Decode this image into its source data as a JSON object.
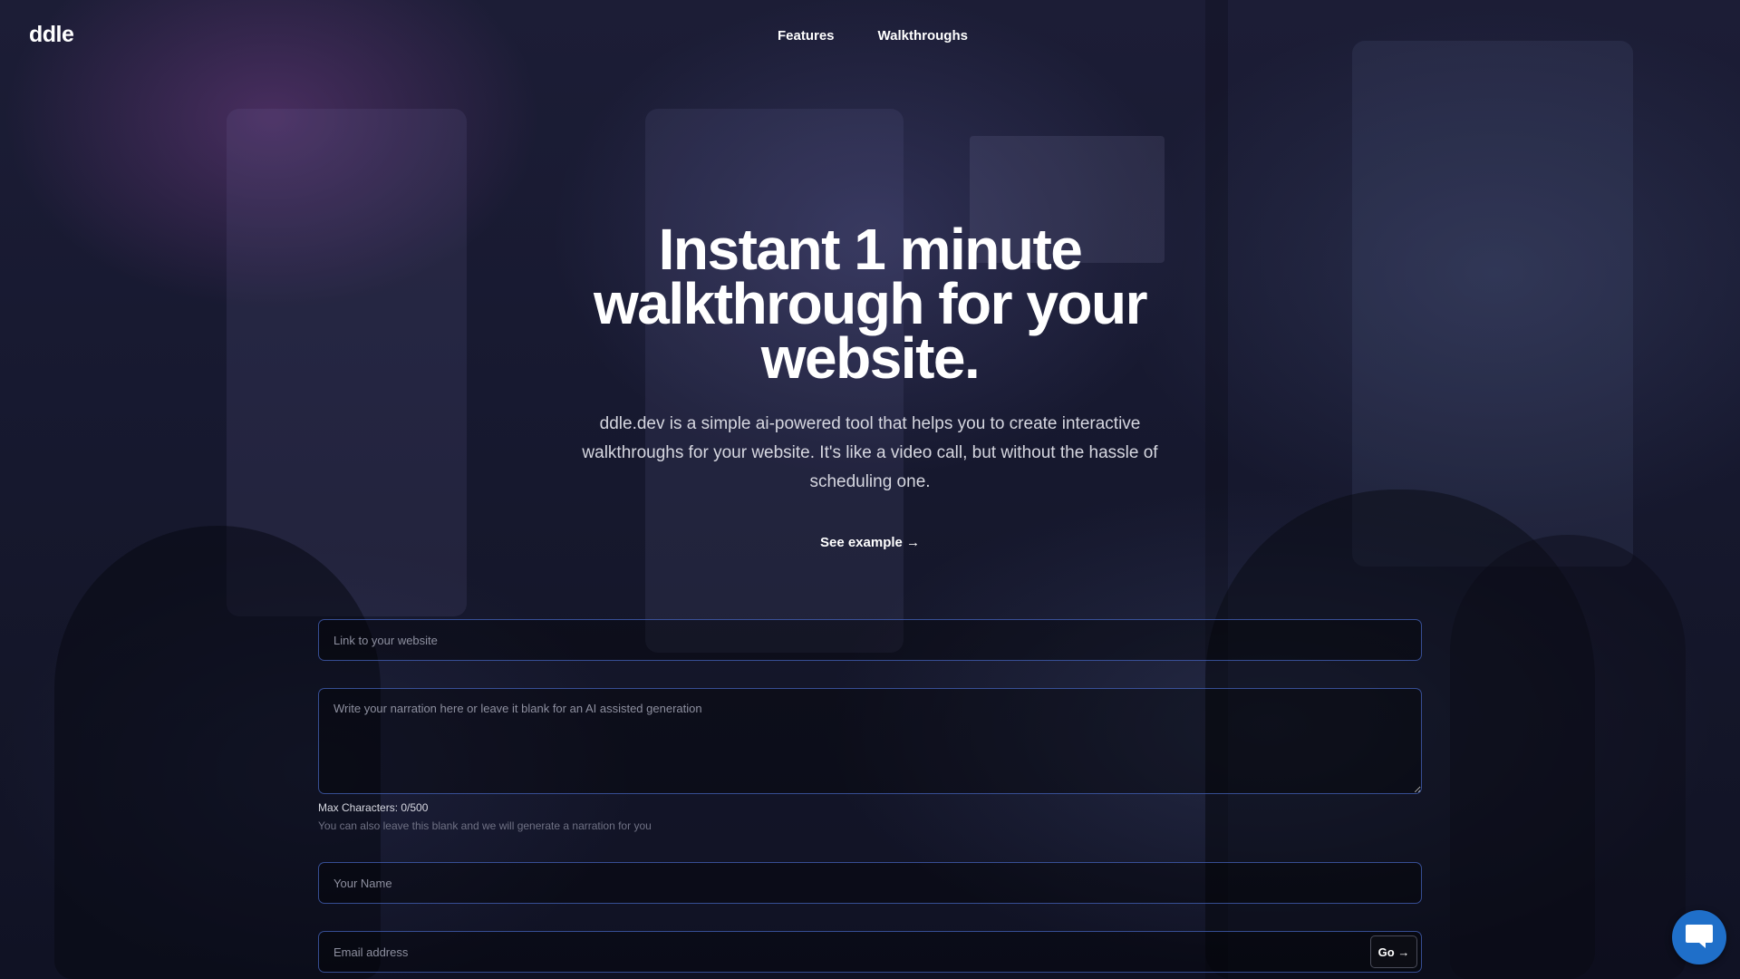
{
  "header": {
    "logo": "ddle",
    "nav": [
      {
        "label": "Features"
      },
      {
        "label": "Walkthroughs"
      }
    ]
  },
  "hero": {
    "title": "Instant 1 minute walkthrough for your website.",
    "subtitle": "ddle.dev is a simple ai-powered tool that helps you to create interactive walkthroughs for your website. It's like a video call, but without the hassle of scheduling one.",
    "see_example": "See example →"
  },
  "form": {
    "url_placeholder": "Link to your website",
    "url_value": "",
    "narration_placeholder": "Write your narration here or leave it blank for an AI assisted generation",
    "narration_value": "",
    "char_count": "Max Characters: 0/500",
    "char_hint": "You can also leave this blank and we will generate a narration for you",
    "name_placeholder": "Your Name",
    "name_value": "",
    "email_placeholder": "Email address",
    "email_value": "",
    "go_label": "Go →"
  },
  "chat": {
    "icon": "chat-bubble-icon",
    "color": "#1f6fc9"
  },
  "colors": {
    "field_border": "#4664be",
    "background": "#171930"
  }
}
